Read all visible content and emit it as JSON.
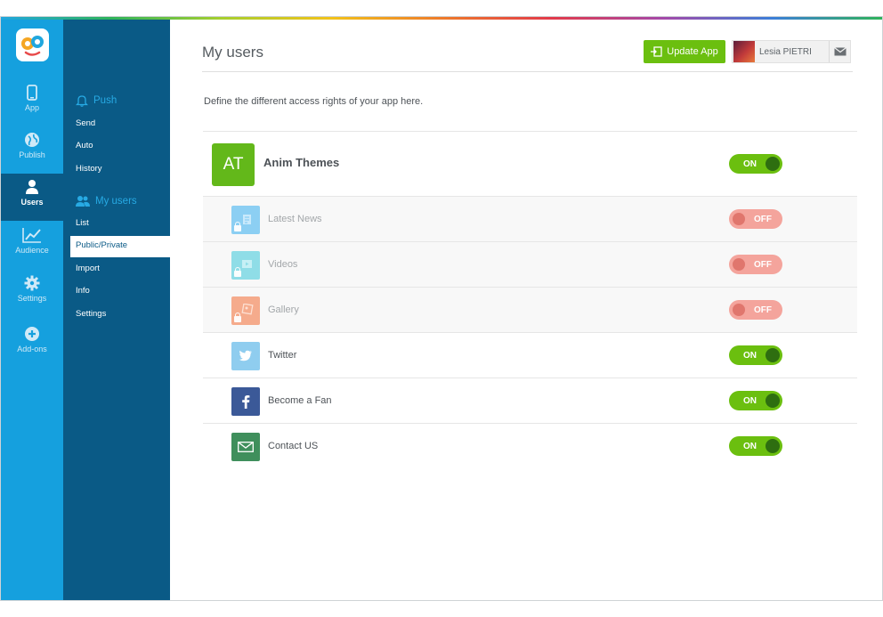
{
  "rail": {
    "items": [
      {
        "label": "App",
        "icon": "phone-icon"
      },
      {
        "label": "Publish",
        "icon": "globe-icon"
      },
      {
        "label": "Users",
        "icon": "user-icon",
        "active": true
      },
      {
        "label": "Audience",
        "icon": "chart-icon"
      },
      {
        "label": "Settings",
        "icon": "gear-icon"
      },
      {
        "label": "Add-ons",
        "icon": "plus-circle-icon"
      }
    ]
  },
  "subnav": {
    "push": {
      "title": "Push",
      "links": [
        "Send",
        "Auto",
        "History"
      ]
    },
    "users": {
      "title": "My users",
      "links": [
        "List",
        "Public/Private",
        "Import",
        "Info",
        "Settings"
      ],
      "active": "Public/Private"
    }
  },
  "header": {
    "title": "My users",
    "update_label": "Update App",
    "user_name": "Lesia PIETRI"
  },
  "intro": "Define the different access rights of your app here.",
  "app_row": {
    "initials": "AT",
    "name": "Anim Themes",
    "status": "ON"
  },
  "items": [
    {
      "label": "Latest News",
      "status": "OFF",
      "locked": true,
      "color": "#8ccff3"
    },
    {
      "label": "Videos",
      "status": "OFF",
      "locked": true,
      "color": "#8fdde7"
    },
    {
      "label": "Gallery",
      "status": "OFF",
      "locked": true,
      "color": "#f5ab8c"
    },
    {
      "label": "Twitter",
      "status": "ON",
      "locked": false,
      "color": "#8fcdef"
    },
    {
      "label": "Become a Fan",
      "status": "ON",
      "locked": false,
      "color": "#3b5998"
    },
    {
      "label": "Contact US",
      "status": "ON",
      "locked": false,
      "color": "#3f8f5c"
    }
  ],
  "colors": {
    "rail": "#15a0de",
    "subnav": "#0a5a86",
    "accent_green": "#6bbf0f",
    "off_red": "#f4a49c"
  }
}
